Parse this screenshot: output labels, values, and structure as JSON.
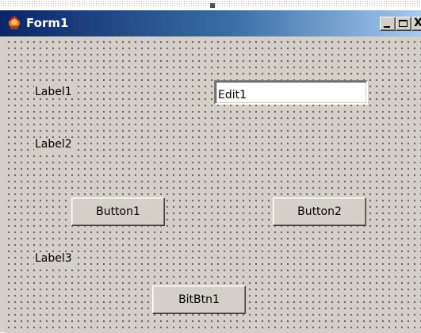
{
  "window": {
    "title": "Form1",
    "icon": "delphi-app-icon",
    "controls": {
      "minimize": "minimize-icon",
      "maximize": "maximize-icon",
      "close": "close-icon",
      "close_glyph": "X"
    }
  },
  "form": {
    "label1": "Label1",
    "label2": "Label2",
    "label3": "Label3",
    "edit1_value": "Edit1",
    "button1": "Button1",
    "button2": "Button2",
    "bitbtn1": "BitBtn1"
  },
  "colors": {
    "form_background": "#d4d0c8",
    "title_gradient_start": "#0a246a",
    "title_gradient_end": "#a6caf0",
    "title_text": "#ffffff",
    "grid_dot": "#000000"
  }
}
